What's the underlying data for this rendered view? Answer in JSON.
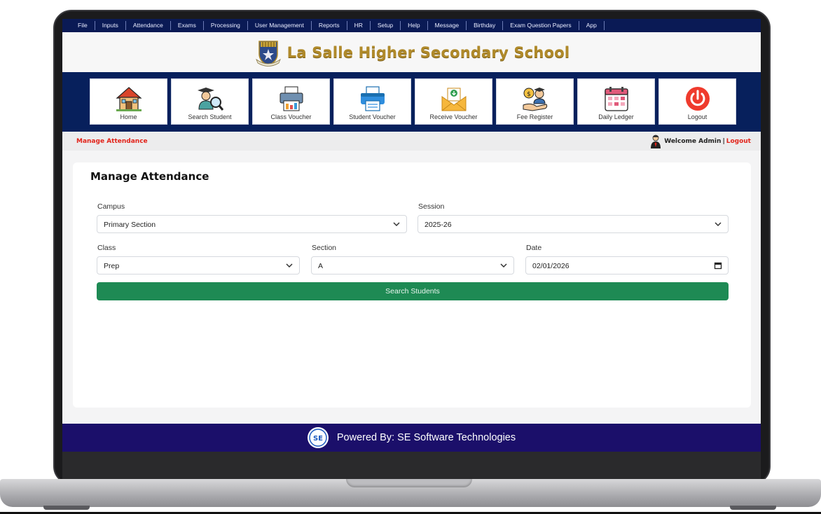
{
  "menu": [
    "File",
    "Inputs",
    "Attendance",
    "Exams",
    "Processing",
    "User Management",
    "Reports",
    "HR",
    "Setup",
    "Help",
    "Message",
    "Birthday",
    "Exam Question Papers",
    "App"
  ],
  "header": {
    "school_name": "La Salle Higher Secondary School"
  },
  "tiles": [
    {
      "label": "Home",
      "icon": "home-icon"
    },
    {
      "label": "Search Student",
      "icon": "search-student-icon"
    },
    {
      "label": "Class Voucher",
      "icon": "class-voucher-icon"
    },
    {
      "label": "Student Voucher",
      "icon": "printer-icon"
    },
    {
      "label": "Receive Voucher",
      "icon": "receive-voucher-icon"
    },
    {
      "label": "Fee Register",
      "icon": "fee-register-icon"
    },
    {
      "label": "Daily Ledger",
      "icon": "calendar-icon"
    },
    {
      "label": "Logout",
      "icon": "power-icon"
    }
  ],
  "breadcrumb": {
    "title": "Manage Attendance",
    "welcome": "Welcome Admin",
    "separator": "|",
    "logout": "Logout"
  },
  "form": {
    "heading": "Manage Attendance",
    "campus": {
      "label": "Campus",
      "value": "Primary Section"
    },
    "session": {
      "label": "Session",
      "value": "2025-26"
    },
    "class": {
      "label": "Class",
      "value": "Prep"
    },
    "section": {
      "label": "Section",
      "value": "A"
    },
    "date": {
      "label": "Date",
      "value": "02/01/2026"
    },
    "search_label": "Search Students"
  },
  "footer": {
    "powered_by": "Powered By: SE Software Technologies",
    "logo_text": "SE"
  },
  "colors": {
    "menu_bg": "#0a1a55",
    "tile_bg": "#07205c",
    "accent_red": "#e2231a",
    "button_green": "#1e8a54",
    "footer_bg": "#1b0f6a",
    "school_gold": "#b08a2a"
  }
}
